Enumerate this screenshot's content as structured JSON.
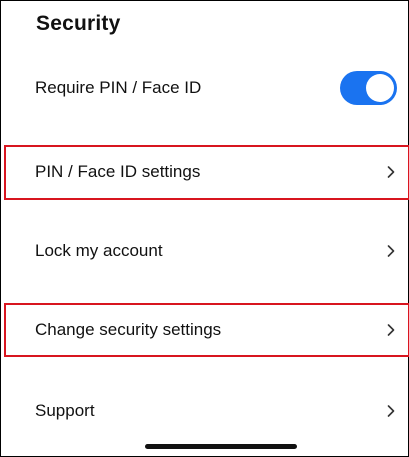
{
  "section": {
    "title": "Security"
  },
  "rows": [
    {
      "label": "Require PIN / Face ID",
      "control": "toggle",
      "toggle_on": true
    },
    {
      "label": "PIN / Face ID settings",
      "control": "chevron",
      "highlighted": true
    },
    {
      "label": "Lock my account",
      "control": "chevron",
      "highlighted": false
    },
    {
      "label": "Change security settings",
      "control": "chevron",
      "highlighted": true
    },
    {
      "label": "Support",
      "control": "chevron",
      "highlighted": false
    }
  ],
  "colors": {
    "toggle_on": "#1a73f0",
    "highlight_border": "#d8151f",
    "text": "#111111"
  },
  "icons": {
    "chevron": "chevron-right-icon"
  }
}
